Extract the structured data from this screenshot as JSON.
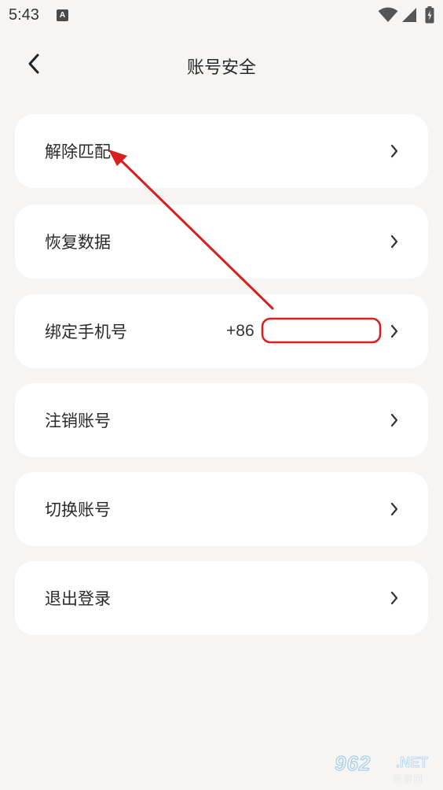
{
  "status_bar": {
    "time": "5:43",
    "notification_letter": "A"
  },
  "header": {
    "title": "账号安全"
  },
  "menu": [
    {
      "label": "解除匹配"
    },
    {
      "label": "恢复数据"
    },
    {
      "label": "绑定手机号",
      "value": "+86"
    },
    {
      "label": "注销账号"
    },
    {
      "label": "切换账号"
    },
    {
      "label": "退出登录"
    }
  ],
  "icons": {
    "back": "chevron-left-icon",
    "item": "chevron-right-icon",
    "wifi": "wifi-icon",
    "signal": "cellular-signal-icon",
    "battery": "battery-charging-icon"
  },
  "watermark": {
    "main": "962",
    "suffix": ".NET",
    "sub": "乐游网"
  },
  "colors": {
    "background": "#f6f5f3",
    "card": "#ffffff",
    "annotation": "#d81e1e"
  }
}
